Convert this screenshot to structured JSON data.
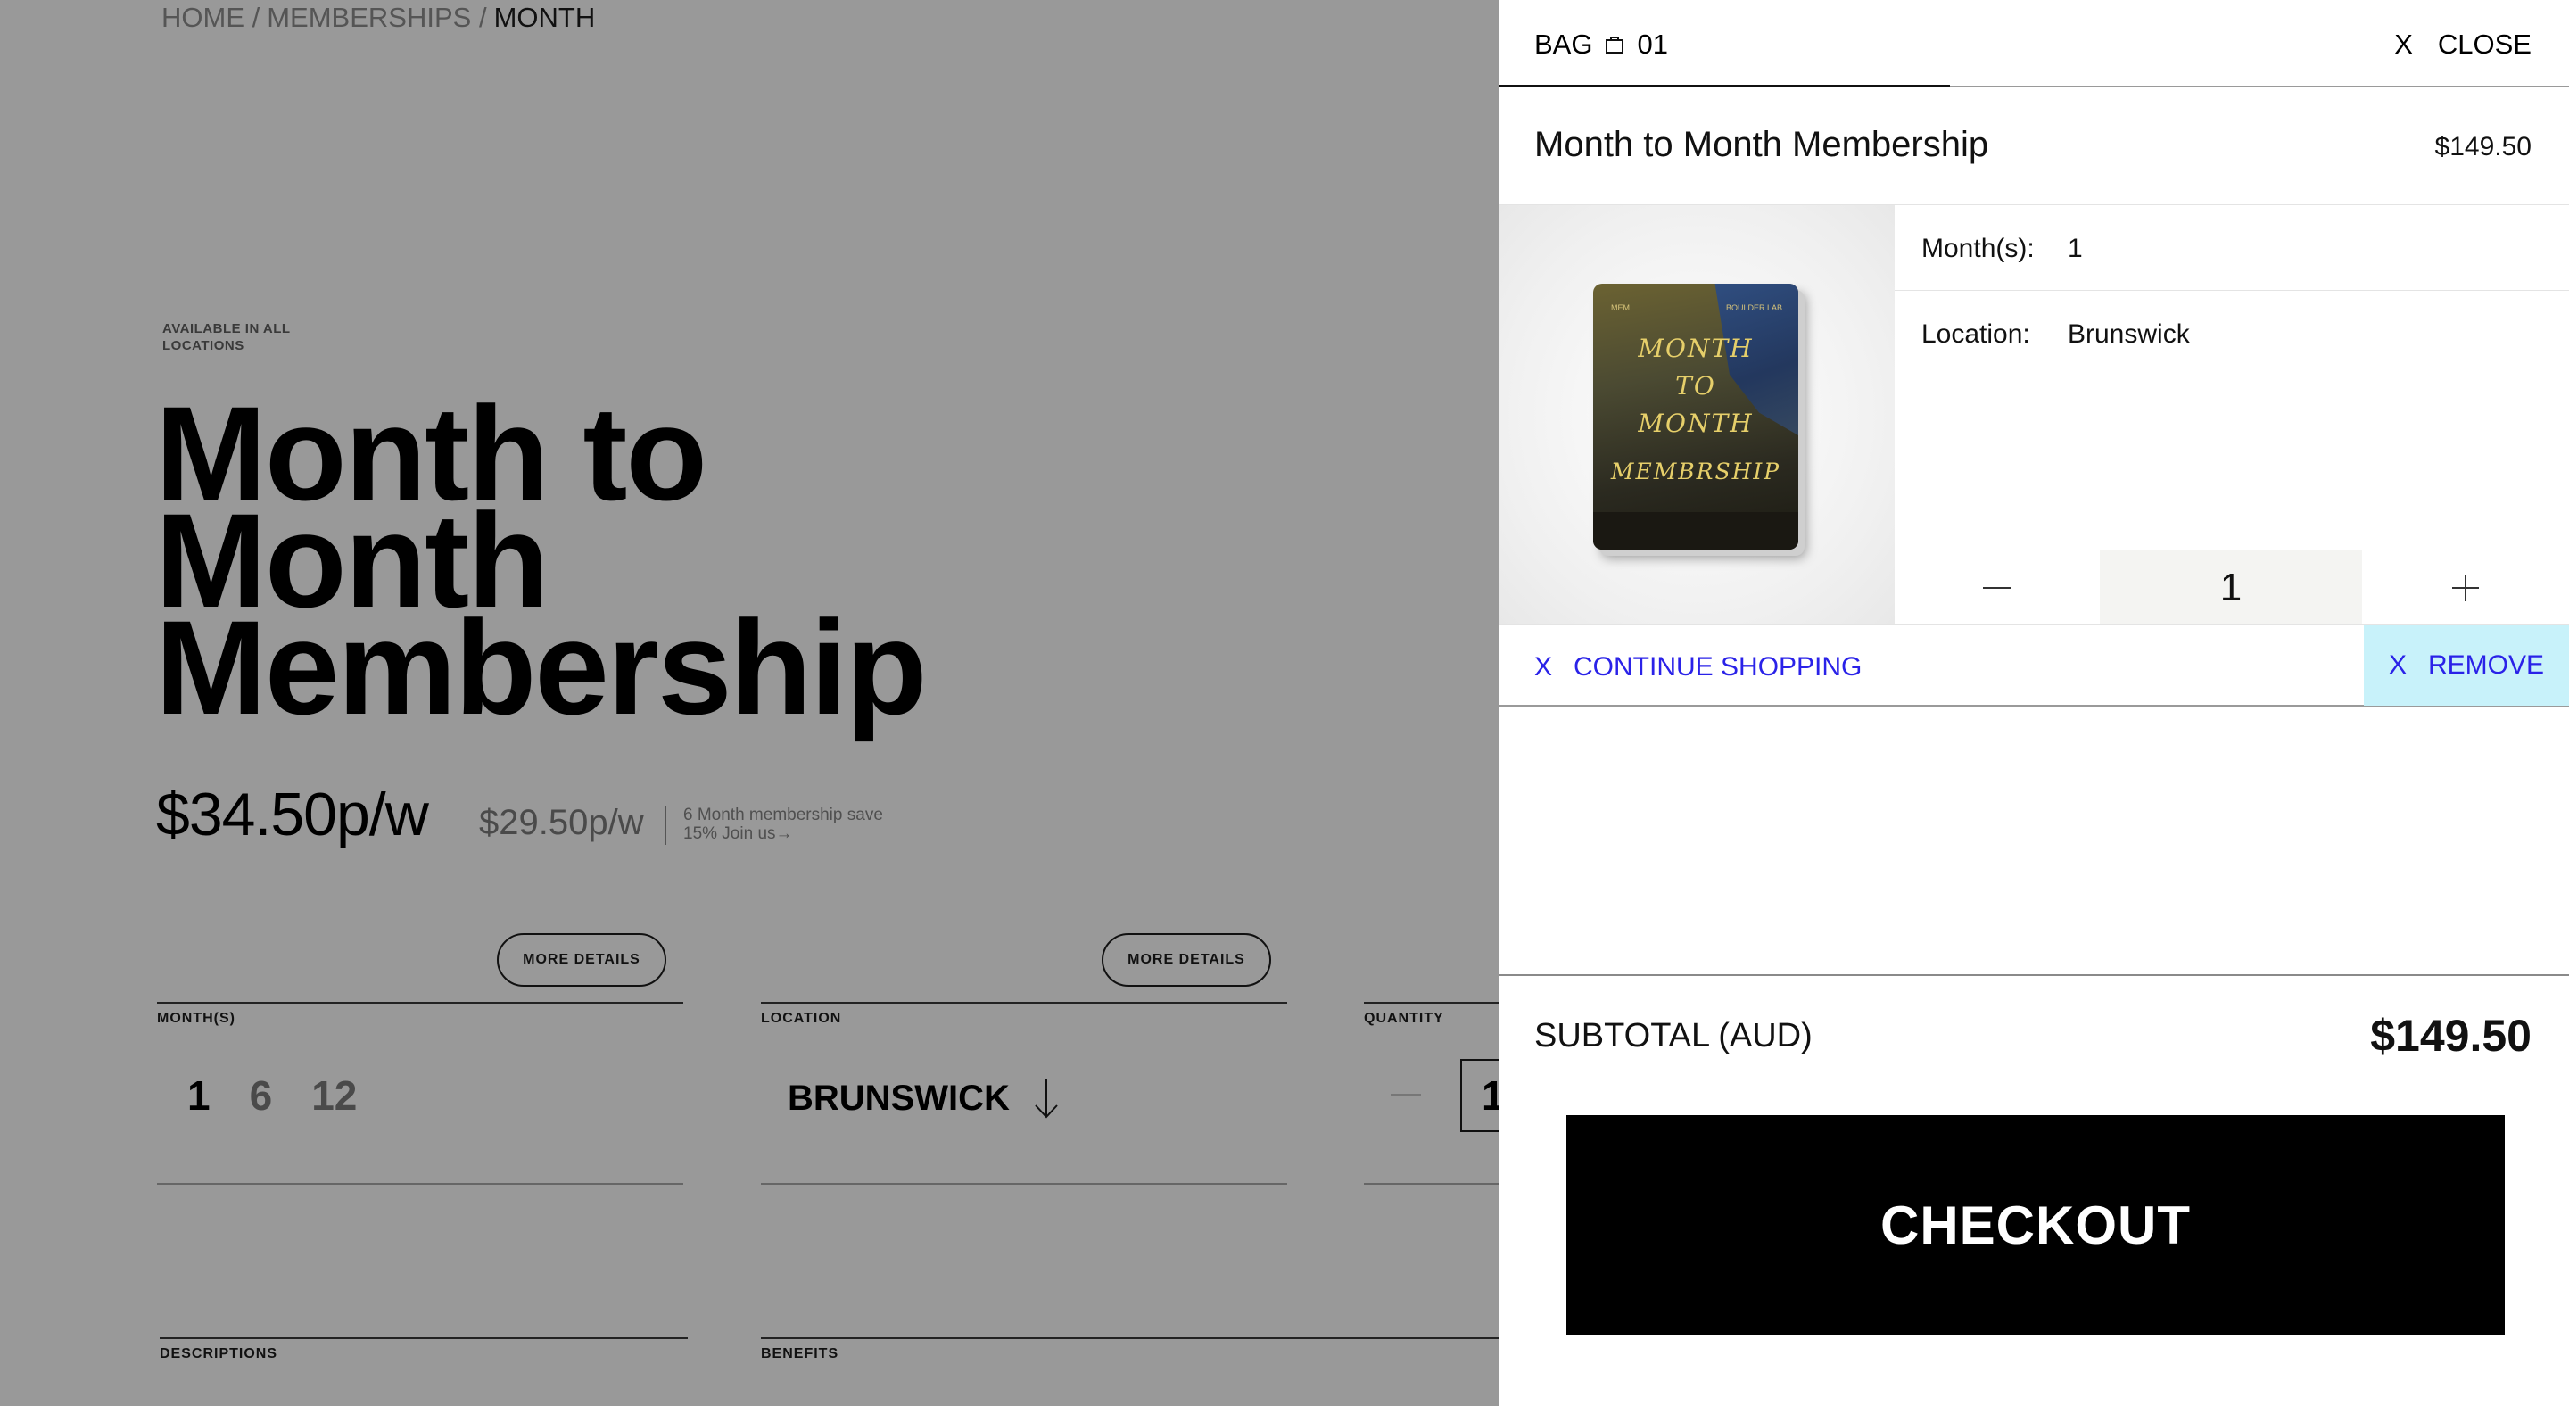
{
  "breadcrumb": {
    "home": "HOME /",
    "memberships": "MEMBERSHIPS /",
    "current": "MONTH"
  },
  "product": {
    "availability": "AVAILABLE IN ALL LOCATIONS",
    "title_line1": "Month to",
    "title_line2": "Month",
    "title_line3": "Membership",
    "price": "$34.50p/w",
    "alt_price": "$29.50p/w",
    "price_note": "6 Month membership save 15% Join us→",
    "more_details_1": "MORE DETAILS",
    "more_details_2": "MORE DETAILS"
  },
  "options": {
    "months_label": "MONTH(S)",
    "months": [
      "1",
      "6",
      "12"
    ],
    "selected_month": "1",
    "location_label": "LOCATION",
    "location_value": "BRUNSWICK",
    "quantity_label": "QUANTITY",
    "quantity_value": "1"
  },
  "sections": {
    "descriptions": "DESCRIPTIONS",
    "benefits": "BENEFITS"
  },
  "cart": {
    "bag_label": "BAG",
    "bag_count": "01",
    "close_x": "X",
    "close_label": "CLOSE",
    "item_name": "Month to Month Membership",
    "item_price": "$149.50",
    "thumbnail": {
      "top_left": "MEM",
      "top_right": "BOULDER LAB",
      "title_1": "MONTH",
      "title_2": "TO",
      "title_3": "MONTH",
      "subtitle": "MEMBRSHIP"
    },
    "months_key": "Month(s):",
    "months_value": "1",
    "location_key": "Location:",
    "location_value": "Brunswick",
    "quantity": "1",
    "minus_icon": "minus-icon",
    "plus_icon": "plus-icon",
    "continue_x": "X",
    "continue_label": "CONTINUE SHOPPING",
    "remove_x": "X",
    "remove_label": "REMOVE",
    "subtotal_label": "SUBTOTAL (AUD)",
    "subtotal_value": "$149.50",
    "checkout_label": "CHECKOUT",
    "link_color": "#2a22e8",
    "remove_bg": "#c8f2fa"
  }
}
